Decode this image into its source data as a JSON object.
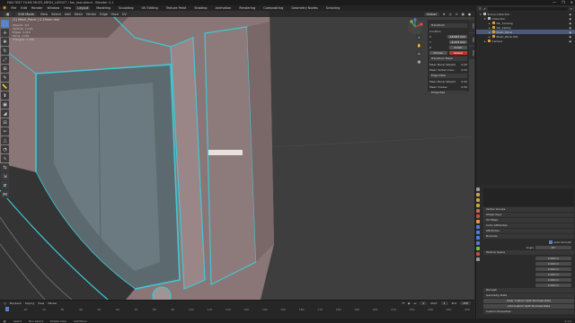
{
  "titlebar": {
    "title": "FAN TEST FILMS MULTI_MESH_LAYOUT / fan_test.blend - Blender 4.1",
    "controls": [
      "—",
      "❐",
      "✕"
    ]
  },
  "menubar": {
    "menus": [
      "File",
      "Edit",
      "Render",
      "Window",
      "Help"
    ],
    "workspaces": [
      "Layout",
      "Modeling",
      "Sculpting",
      "UV Editing",
      "Texture Paint",
      "Shading",
      "Animation",
      "Rendering",
      "Compositing",
      "Geometry Nodes",
      "Scripting"
    ],
    "active_workspace": "Layout",
    "scene": "Scene",
    "view_layer": "ViewLayer"
  },
  "viewport_header": {
    "mode": "Edit Mode",
    "menus": [
      "View",
      "Select",
      "Add",
      "Mesh",
      "Vertex",
      "Edge",
      "Face",
      "UV"
    ],
    "orientation": "Global",
    "object_crumb": "(1) Mesh_Panel | 2.25mm mm"
  },
  "stats": "Objects  1/4\nVertices  1,116\nEdges  2,314\nFaces  1,201\nTriangles  2,398",
  "npanel": {
    "tabs": [
      "Item",
      "Tool",
      "View"
    ],
    "transform_label": "Transform",
    "location_label": "Location",
    "values": [
      "-16.597 mm",
      "-4.213 mm",
      "0 mm"
    ],
    "header_btn": "Median",
    "edit_btn": "Global",
    "section2": "Transform Mesh",
    "rows": [
      {
        "label": "Mean Bevel Weight",
        "value": "0.00"
      },
      {
        "label": "Mean Vertex Crea..",
        "value": "0.00"
      }
    ],
    "section3": "Edge Data",
    "rows2": [
      {
        "label": "Mean Bevel Weight",
        "value": "0.00"
      },
      {
        "label": "Mean Crease",
        "value": "0.00"
      }
    ],
    "section4": "Properties"
  },
  "outliner": {
    "search_placeholder": "",
    "items": [
      {
        "label": "Scene Collection",
        "indent": 0,
        "type": "col"
      },
      {
        "label": "Collection",
        "indent": 1,
        "type": "col"
      },
      {
        "label": "fan_housing",
        "indent": 2,
        "type": "obj"
      },
      {
        "label": "fan_blades",
        "indent": 2,
        "type": "obj"
      },
      {
        "label": "Mesh_Panel",
        "indent": 2,
        "type": "obj",
        "selected": true
      },
      {
        "label": "Mesh_Panel.001",
        "indent": 2,
        "type": "obj"
      },
      {
        "label": "Camera",
        "indent": 1,
        "type": "obj"
      }
    ]
  },
  "properties": {
    "sections": [
      "Vertex Groups",
      "Shape Keys",
      "UV Maps",
      "Color Attributes",
      "Attributes",
      "Normals",
      "Texture Space",
      "Remesh",
      "Geometry Data",
      "Custom Properties"
    ],
    "active_section": "Normals",
    "auto_smooth_label": "Auto Smooth",
    "angle_label": "Angle",
    "angle_value": "30°",
    "add_custom_split": "Add Custom Split Normals Data",
    "clear_custom_split": "Clear Custom Split Normals Data",
    "fields": [
      "0.000 m",
      "0.000 m",
      "0.000 m",
      "0.000 m",
      "0.000 m",
      "0.000 m"
    ]
  },
  "timeline": {
    "menus": [
      "Playback",
      "Keying",
      "View",
      "Marker"
    ],
    "frame_current": "1",
    "start_label": "Start",
    "start": "1",
    "end_label": "End",
    "end": "250",
    "ticks": [
      "0",
      "10",
      "20",
      "30",
      "40",
      "50",
      "60",
      "70",
      "80",
      "90",
      "100",
      "110",
      "120",
      "130",
      "140",
      "150",
      "160",
      "170",
      "180",
      "190",
      "200",
      "210",
      "220",
      "230",
      "240",
      "250"
    ]
  },
  "statusbar": {
    "items": [
      "Select",
      "Box Select",
      "Rotate View",
      "Call Menu"
    ],
    "version": "4.1.0"
  },
  "colors": {
    "accent": "#5680c2",
    "selection": "#3fc9d6",
    "mesh": "#8e7a79",
    "red_btn": "#c5332e",
    "object_icon": "#e19d3a"
  }
}
